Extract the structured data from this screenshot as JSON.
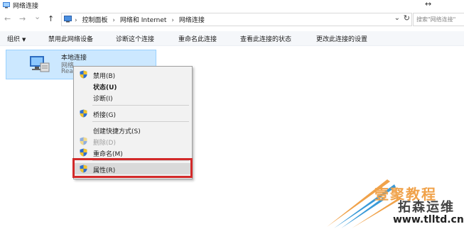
{
  "window": {
    "title": "网络连接",
    "resize_glyph": "↔"
  },
  "nav": {
    "back": "←",
    "forward": "→",
    "recent": "⌄",
    "up": "↑"
  },
  "address": {
    "crumbs": [
      "控制面板",
      "网络和 Internet",
      "网络连接"
    ],
    "separator": "›",
    "dropdown": "⌄",
    "refresh": "↻"
  },
  "search": {
    "placeholder": "搜索\"网络连接\""
  },
  "commands": {
    "organize": "组织",
    "disable": "禁用此网络设备",
    "diagnose": "诊断这个连接",
    "rename": "重命名此连接",
    "view_status": "查看此连接的状态",
    "change_settings": "更改此连接的设置"
  },
  "connection": {
    "name": "本地连接",
    "type": "网络",
    "status": "Rea"
  },
  "context_menu": {
    "disable": "禁用(B)",
    "status": "状态(U)",
    "diagnose": "诊断(I)",
    "bridge": "桥接(G)",
    "shortcut": "创建快捷方式(S)",
    "delete": "删除(D)",
    "rename": "重命名(M)",
    "properties": "属性(R)"
  },
  "watermark": {
    "line1": "壹聚教程",
    "line2": "拓森运维",
    "line3": "www.tlltd.cn"
  },
  "colors": {
    "selection": "#cce8ff",
    "highlight_border": "#d22a2a",
    "shield_blue": "#2f6fcf",
    "shield_yellow": "#f2c32b"
  }
}
